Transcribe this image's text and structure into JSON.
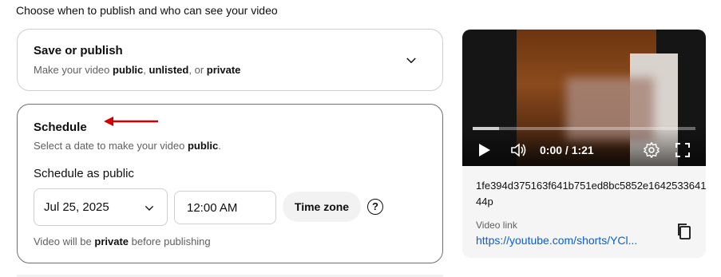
{
  "intro": "Choose when to publish and who can see your video",
  "save_card": {
    "title": "Save or publish",
    "sub_prefix": "Make your video ",
    "opt_public": "public",
    "sep1": ", ",
    "opt_unlisted": "unlisted",
    "sep2": ", or ",
    "opt_private": "private"
  },
  "schedule_card": {
    "title": "Schedule",
    "sub_prefix": "Select a date to make your video ",
    "sub_bold": "public",
    "sub_suffix": ".",
    "schedule_as": "Schedule as public",
    "date": "Jul 25, 2025",
    "time": "12:00 AM",
    "timezone_button": "Time zone",
    "help": "?",
    "note_prefix": "Video will be ",
    "note_bold": "private",
    "note_suffix": " before publishing"
  },
  "video": {
    "time_display": "0:00 / 1:21",
    "progress_fraction": 0.12,
    "id": "1fe394d375163f641b751ed8bc5852e164253364144p",
    "link_label": "Video link",
    "link": "https://youtube.com/shorts/YCl..."
  },
  "icons": {
    "dropdown": "chevron-down-icon",
    "annotation": "red-arrow-icon",
    "help": "help-icon",
    "play": "play-icon",
    "volume": "volume-icon",
    "settings": "gear-icon",
    "fullscreen": "fullscreen-icon",
    "copy": "copy-icon"
  },
  "colors": {
    "arrow": "#d40000",
    "link": "#065fd4",
    "border_active": "#6f6f6f"
  }
}
